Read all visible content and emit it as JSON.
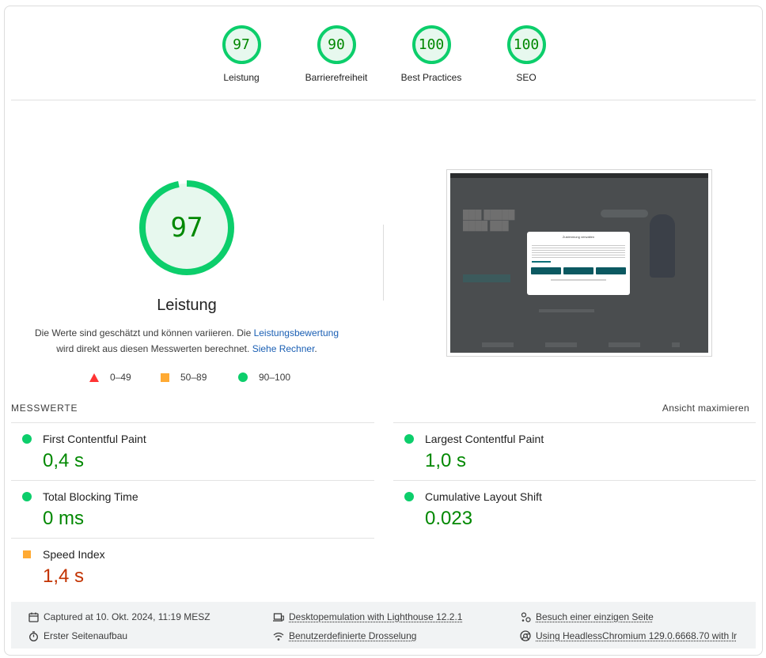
{
  "categories": [
    {
      "score": "97",
      "label": "Leistung"
    },
    {
      "score": "90",
      "label": "Barrierefreiheit"
    },
    {
      "score": "100",
      "label": "Best Practices"
    },
    {
      "score": "100",
      "label": "SEO"
    }
  ],
  "performance": {
    "score": "97",
    "score_fraction": 0.97,
    "title": "Leistung",
    "desc_part1": "Die Werte sind geschätzt und können variieren. Die ",
    "desc_link1": "Leistungsbewertung",
    "desc_part2": " wird direkt aus diesen Messwerten berechnet. ",
    "desc_link2": "Siehe Rechner",
    "desc_part3": "."
  },
  "legend": [
    {
      "icon": "fail-triangle-icon",
      "range": "0–49",
      "color": "#ff3333"
    },
    {
      "icon": "average-square-icon",
      "range": "50–89",
      "color": "#ffaa33"
    },
    {
      "icon": "pass-circle-icon",
      "range": "90–100",
      "color": "#0cce6b"
    }
  ],
  "screenshot": {
    "dialog_title": "Zustimmung verwalten"
  },
  "metrics": {
    "heading": "Messwerte",
    "expand_label": "Ansicht maximieren",
    "items": [
      {
        "label": "First Contentful Paint",
        "value": "0,4 s",
        "rating": "pass"
      },
      {
        "label": "Largest Contentful Paint",
        "value": "1,0 s",
        "rating": "pass"
      },
      {
        "label": "Total Blocking Time",
        "value": "0 ms",
        "rating": "pass"
      },
      {
        "label": "Cumulative Layout Shift",
        "value": "0.023",
        "rating": "pass"
      },
      {
        "label": "Speed Index",
        "value": "1,4 s",
        "rating": "average"
      }
    ]
  },
  "footer": {
    "captured": "Captured at 10. Okt. 2024, 11:19 MESZ",
    "load_type": "Erster Seitenaufbau",
    "emulation": "Desktopemulation with Lighthouse 12.2.1",
    "throttling": "Benutzerdefinierte Drosselung",
    "session": "Besuch einer einzigen Seite",
    "browser": "Using HeadlessChromium 129.0.6668.70 with lr"
  },
  "colors": {
    "pass": "#0cce6b",
    "pass_text": "#008800",
    "average": "#ffaa33",
    "average_text": "#c33300",
    "fail": "#ff3333"
  }
}
